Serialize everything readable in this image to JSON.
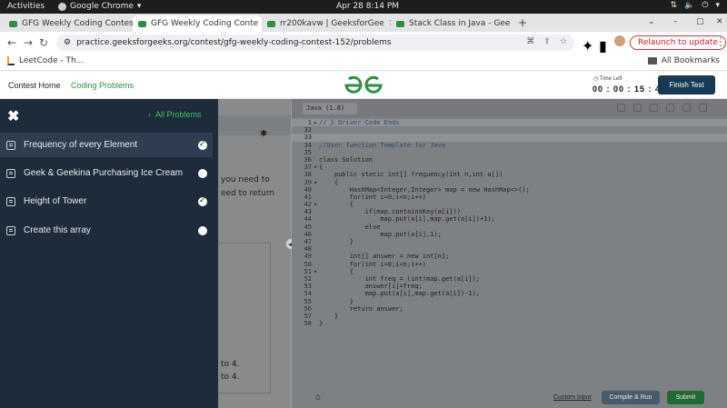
{
  "system": {
    "activities": "Activities",
    "app_name": "Google Chrome",
    "clock": "Apr 28  8:14 PM"
  },
  "tabs": [
    {
      "title": "GFG Weekly Coding Contes",
      "active": false
    },
    {
      "title": "GFG Weekly Coding Conte",
      "active": true
    },
    {
      "title": "rr200kavw | GeeksforGee",
      "active": false
    },
    {
      "title": "Stack Class in Java - Geek",
      "active": false
    }
  ],
  "address": {
    "url": "practice.geeksforgeeks.org/contest/gfg-weekly-coding-contest-152/problems",
    "relaunch": "Relaunch to update"
  },
  "bookmarks": {
    "left": "LeetCode - Th...",
    "right": "All Bookmarks"
  },
  "header": {
    "contest_home": "Contest Home",
    "coding_problems": "Coding Problems",
    "time_left_label": "Time Left",
    "time_left": "00 : 00 : 15 : 40",
    "finish": "Finish Test",
    "brand_color": "#2f8d46"
  },
  "drawer": {
    "all_problems": "All Problems",
    "items": [
      {
        "label": "Frequency of every Element",
        "solved": true,
        "selected": true
      },
      {
        "label": "Geek & Geekina Purchasing Ice Cream",
        "solved": false,
        "selected": false
      },
      {
        "label": "Height of Tower",
        "solved": true,
        "selected": false
      },
      {
        "label": "Create this array",
        "solved": false,
        "selected": false
      }
    ]
  },
  "problem_peek": {
    "line1": "you need to",
    "line2": "eed to return",
    "line3": "to  4.",
    "line4": "to  4."
  },
  "editor": {
    "language": "Java (1.8)",
    "lines": [
      {
        "n": "1",
        "fold": "▸",
        "text": "// } Driver Code Ends",
        "cls": "cm",
        "hl": true
      },
      {
        "n": "32",
        "fold": "",
        "text": "",
        "cls": "",
        "hl": false
      },
      {
        "n": "33",
        "fold": "",
        "text": "",
        "cls": "",
        "hl": true
      },
      {
        "n": "34",
        "fold": "",
        "text": "//User function Template for Java",
        "cls": "cm",
        "hl": false
      },
      {
        "n": "35",
        "fold": "",
        "text": "",
        "cls": "",
        "hl": false
      },
      {
        "n": "36",
        "fold": "",
        "text": "class Solution",
        "cls": "",
        "hl": false
      },
      {
        "n": "37",
        "fold": "▾",
        "text": "{",
        "cls": "",
        "hl": false
      },
      {
        "n": "38",
        "fold": "",
        "text": "    public static int[] frequency(int n,int a[])",
        "cls": "",
        "hl": false
      },
      {
        "n": "39",
        "fold": "▾",
        "text": "    {",
        "cls": "",
        "hl": false
      },
      {
        "n": "40",
        "fold": "",
        "text": "        HashMap<Integer,Integer> map = new HashMap<>();",
        "cls": "",
        "hl": false
      },
      {
        "n": "41",
        "fold": "",
        "text": "        for(int i=0;i<n;i++)",
        "cls": "",
        "hl": false
      },
      {
        "n": "42",
        "fold": "▾",
        "text": "        {",
        "cls": "",
        "hl": false
      },
      {
        "n": "43",
        "fold": "",
        "text": "            if(map.containsKey(a[i]))",
        "cls": "",
        "hl": false
      },
      {
        "n": "44",
        "fold": "",
        "text": "                map.put(a[i],map.get(a[i])+1);",
        "cls": "",
        "hl": false
      },
      {
        "n": "45",
        "fold": "",
        "text": "            else",
        "cls": "",
        "hl": false
      },
      {
        "n": "46",
        "fold": "",
        "text": "                map.put(a[i],1);",
        "cls": "",
        "hl": false
      },
      {
        "n": "47",
        "fold": "",
        "text": "        }",
        "cls": "",
        "hl": false
      },
      {
        "n": "48",
        "fold": "",
        "text": "",
        "cls": "",
        "hl": false
      },
      {
        "n": "49",
        "fold": "",
        "text": "        int[] answer = new int[n];",
        "cls": "",
        "hl": false
      },
      {
        "n": "50",
        "fold": "",
        "text": "        for(int i=0;i<n;i++)",
        "cls": "",
        "hl": false
      },
      {
        "n": "51",
        "fold": "▾",
        "text": "        {",
        "cls": "",
        "hl": false
      },
      {
        "n": "52",
        "fold": "",
        "text": "            int freq = (int)map.get(a[i]);",
        "cls": "",
        "hl": false
      },
      {
        "n": "53",
        "fold": "",
        "text": "            answer[i]=freq;",
        "cls": "",
        "hl": false
      },
      {
        "n": "54",
        "fold": "",
        "text": "            map.put(a[i],map.get(a[i])-1);",
        "cls": "",
        "hl": false
      },
      {
        "n": "55",
        "fold": "",
        "text": "        }",
        "cls": "",
        "hl": false
      },
      {
        "n": "56",
        "fold": "",
        "text": "        return answer;",
        "cls": "",
        "hl": false
      },
      {
        "n": "57",
        "fold": "",
        "text": "    }",
        "cls": "",
        "hl": false
      },
      {
        "n": "58",
        "fold": "",
        "text": "}",
        "cls": "",
        "hl": false
      }
    ],
    "custom_input": "Custom Input",
    "compile": "Compile & Run",
    "submit": "Submit"
  }
}
